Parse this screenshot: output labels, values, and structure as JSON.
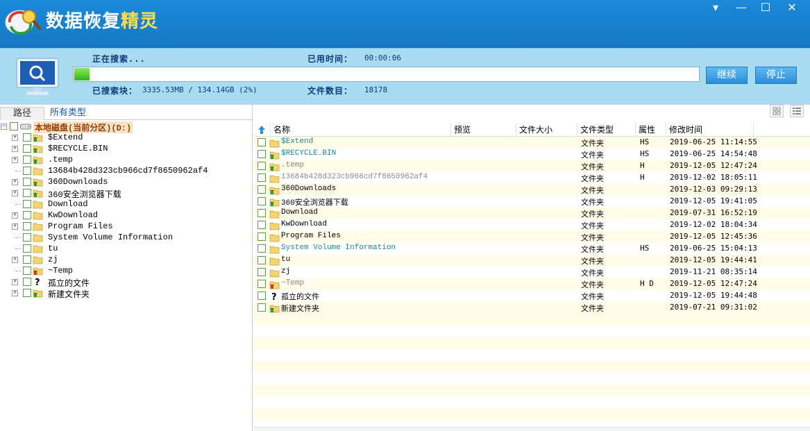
{
  "app": {
    "title_part1": "数据恢复",
    "title_part2": "精灵"
  },
  "window_controls": {
    "menu": "▾",
    "minimize": "—",
    "maximize": "☐",
    "close": "✕"
  },
  "scan": {
    "status_label": "正在搜索...",
    "elapsed_label": "已用时间：",
    "elapsed_value": "00:00:06",
    "blocks_label": "已搜索块：",
    "blocks_value": "3335.53MB / 134.14GB (2%)",
    "files_label": "文件数目：",
    "files_value": "18178",
    "progress_fraction": 0.024,
    "continue_button": "继续",
    "stop_button": "停止"
  },
  "left_tabs": {
    "path": "路径",
    "all_types": "所有类型"
  },
  "tree": {
    "root": "本地磁盘(当前分区)(D:)",
    "items": [
      {
        "name": "$Extend",
        "expandable": true,
        "icon": "folder-recycle-icon"
      },
      {
        "name": "$RECYCLE.BIN",
        "expandable": true,
        "icon": "folder-recycle-icon"
      },
      {
        "name": ".temp",
        "expandable": true,
        "icon": "folder-recycle-icon"
      },
      {
        "name": "13684b428d323cb966cd7f8650962af4",
        "expandable": false,
        "icon": "folder-icon"
      },
      {
        "name": "360Downloads",
        "expandable": true,
        "icon": "folder-recycle-icon"
      },
      {
        "name": "360安全浏览器下载",
        "expandable": true,
        "icon": "folder-recycle-icon"
      },
      {
        "name": "Download",
        "expandable": false,
        "icon": "folder-icon"
      },
      {
        "name": "KwDownload",
        "expandable": true,
        "icon": "folder-icon"
      },
      {
        "name": "Program Files",
        "expandable": true,
        "icon": "folder-icon"
      },
      {
        "name": "System Volume Information",
        "expandable": false,
        "icon": "folder-icon"
      },
      {
        "name": "tu",
        "expandable": false,
        "icon": "folder-icon"
      },
      {
        "name": "zj",
        "expandable": true,
        "icon": "folder-icon"
      },
      {
        "name": "~Temp",
        "expandable": false,
        "icon": "folder-deleted-icon"
      },
      {
        "name": "孤立的文件",
        "expandable": true,
        "icon": "question-icon"
      },
      {
        "name": "新建文件夹",
        "expandable": true,
        "icon": "folder-recycle-icon"
      }
    ]
  },
  "table": {
    "columns": {
      "name": "名称",
      "preview": "预览",
      "size": "文件大小",
      "type": "文件类型",
      "attr": "属性",
      "mtime": "修改时间"
    },
    "rows": [
      {
        "name": "$Extend",
        "type": "文件夹",
        "attr": "HS",
        "mtime": "2019-06-25 11:14:55",
        "color": "#1a8a8a",
        "icon": "folder-icon"
      },
      {
        "name": "$RECYCLE.BIN",
        "type": "文件夹",
        "attr": "HS",
        "mtime": "2019-06-25 14:54:48",
        "color": "#1a8a8a",
        "icon": "folder-recycle-icon"
      },
      {
        "name": ".temp",
        "type": "文件夹",
        "attr": "H",
        "mtime": "2019-12-05 12:47:24",
        "color": "#888888",
        "icon": "folder-recycle-icon"
      },
      {
        "name": "13684b428d323cb966cd7f8650962af4",
        "type": "文件夹",
        "attr": "H",
        "mtime": "2019-12-02 18:05:11",
        "color": "#888888",
        "icon": "folder-icon"
      },
      {
        "name": "360Downloads",
        "type": "文件夹",
        "attr": "",
        "mtime": "2019-12-03 09:29:13",
        "color": "#000000",
        "icon": "folder-recycle-icon"
      },
      {
        "name": "360安全浏览器下载",
        "type": "文件夹",
        "attr": "",
        "mtime": "2019-12-05 19:41:05",
        "color": "#000000",
        "icon": "folder-recycle-icon"
      },
      {
        "name": "Download",
        "type": "文件夹",
        "attr": "",
        "mtime": "2019-07-31 16:52:19",
        "color": "#000000",
        "icon": "folder-icon"
      },
      {
        "name": "KwDownload",
        "type": "文件夹",
        "attr": "",
        "mtime": "2019-12-02 18:04:34",
        "color": "#000000",
        "icon": "folder-icon"
      },
      {
        "name": "Program Files",
        "type": "文件夹",
        "attr": "",
        "mtime": "2019-12-05 12:45:36",
        "color": "#000000",
        "icon": "folder-icon"
      },
      {
        "name": "System Volume Information",
        "type": "文件夹",
        "attr": "HS",
        "mtime": "2019-06-25 15:04:13",
        "color": "#1a8a8a",
        "icon": "folder-icon"
      },
      {
        "name": "tu",
        "type": "文件夹",
        "attr": "",
        "mtime": "2019-12-05 19:44:41",
        "color": "#000000",
        "icon": "folder-icon"
      },
      {
        "name": "zj",
        "type": "文件夹",
        "attr": "",
        "mtime": "2019-11-21 08:35:14",
        "color": "#000000",
        "icon": "folder-icon"
      },
      {
        "name": "~Temp",
        "type": "文件夹",
        "attr": "H D",
        "mtime": "2019-12-05 12:47:24",
        "color": "#888888",
        "icon": "folder-deleted-icon"
      },
      {
        "name": "孤立的文件",
        "type": "文件夹",
        "attr": "",
        "mtime": "2019-12-05 19:44:48",
        "color": "#000000",
        "icon": "question-icon"
      },
      {
        "name": "新建文件夹",
        "type": "文件夹",
        "attr": "",
        "mtime": "2019-07-21 09:31:02",
        "color": "#000000",
        "icon": "folder-recycle-icon"
      }
    ]
  }
}
